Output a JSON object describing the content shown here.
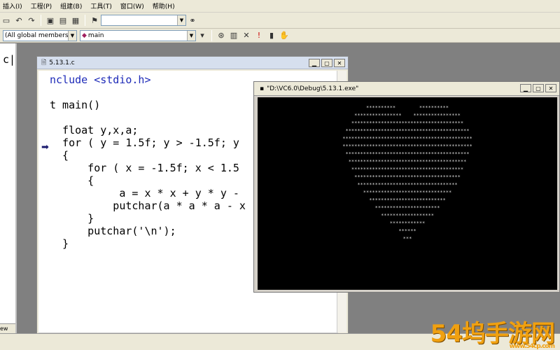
{
  "menu": {
    "items": [
      "插入(I)",
      "工程(P)",
      "组建(B)",
      "工具(T)",
      "窗口(W)",
      "帮助(H)"
    ]
  },
  "toolbar": {
    "scope_combo": "(All global members",
    "function_combo": "main"
  },
  "left_pane": {
    "glyph": "c|",
    "tab_label": "ew"
  },
  "editor": {
    "title": "5.13.1.c",
    "lines": [
      "ncl​ude <stdio.h>",
      "",
      "t main()",
      "",
      "  float y,x,a;",
      "  for ( y = 1.5f; y > -1.5f; y",
      "  {",
      "      for ( x = -1.5f; x < 1.5",
      "      {",
      "           a = x * x + y * y -",
      "          putchar(a * a * a - x",
      "      }",
      "      putchar('\\n');",
      "  }"
    ]
  },
  "console": {
    "title": "\"D:\\VC6.0\\Debug\\5.13.1.exe\"",
    "output": "**********        **********\n****************    ****************\n**************************************\n******************************************\n********************************************\n********************************************\n******************************************\n****************************************\n**************************************\n************************************\n**********************************\n******************************\n**************************\n**********************\n******************\n************\n******\n***"
  },
  "watermark": {
    "logo_text": "54坞手游网",
    "sub_text": "www.54cp.com"
  },
  "colors": {
    "chrome": "#ece9d8",
    "keyword": "#1d2ab8",
    "console_bg": "#000000",
    "console_fg": "#d8d8d8",
    "watermark": "#f0a010"
  }
}
